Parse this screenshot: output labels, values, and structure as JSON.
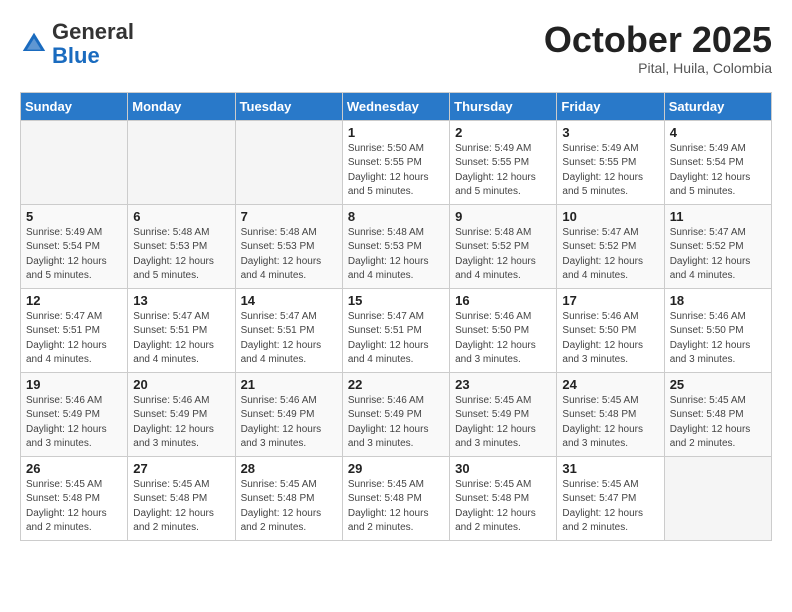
{
  "header": {
    "logo_general": "General",
    "logo_blue": "Blue",
    "month": "October 2025",
    "location": "Pital, Huila, Colombia"
  },
  "weekdays": [
    "Sunday",
    "Monday",
    "Tuesday",
    "Wednesday",
    "Thursday",
    "Friday",
    "Saturday"
  ],
  "weeks": [
    [
      {
        "day": "",
        "info": ""
      },
      {
        "day": "",
        "info": ""
      },
      {
        "day": "",
        "info": ""
      },
      {
        "day": "1",
        "info": "Sunrise: 5:50 AM\nSunset: 5:55 PM\nDaylight: 12 hours\nand 5 minutes."
      },
      {
        "day": "2",
        "info": "Sunrise: 5:49 AM\nSunset: 5:55 PM\nDaylight: 12 hours\nand 5 minutes."
      },
      {
        "day": "3",
        "info": "Sunrise: 5:49 AM\nSunset: 5:55 PM\nDaylight: 12 hours\nand 5 minutes."
      },
      {
        "day": "4",
        "info": "Sunrise: 5:49 AM\nSunset: 5:54 PM\nDaylight: 12 hours\nand 5 minutes."
      }
    ],
    [
      {
        "day": "5",
        "info": "Sunrise: 5:49 AM\nSunset: 5:54 PM\nDaylight: 12 hours\nand 5 minutes."
      },
      {
        "day": "6",
        "info": "Sunrise: 5:48 AM\nSunset: 5:53 PM\nDaylight: 12 hours\nand 5 minutes."
      },
      {
        "day": "7",
        "info": "Sunrise: 5:48 AM\nSunset: 5:53 PM\nDaylight: 12 hours\nand 4 minutes."
      },
      {
        "day": "8",
        "info": "Sunrise: 5:48 AM\nSunset: 5:53 PM\nDaylight: 12 hours\nand 4 minutes."
      },
      {
        "day": "9",
        "info": "Sunrise: 5:48 AM\nSunset: 5:52 PM\nDaylight: 12 hours\nand 4 minutes."
      },
      {
        "day": "10",
        "info": "Sunrise: 5:47 AM\nSunset: 5:52 PM\nDaylight: 12 hours\nand 4 minutes."
      },
      {
        "day": "11",
        "info": "Sunrise: 5:47 AM\nSunset: 5:52 PM\nDaylight: 12 hours\nand 4 minutes."
      }
    ],
    [
      {
        "day": "12",
        "info": "Sunrise: 5:47 AM\nSunset: 5:51 PM\nDaylight: 12 hours\nand 4 minutes."
      },
      {
        "day": "13",
        "info": "Sunrise: 5:47 AM\nSunset: 5:51 PM\nDaylight: 12 hours\nand 4 minutes."
      },
      {
        "day": "14",
        "info": "Sunrise: 5:47 AM\nSunset: 5:51 PM\nDaylight: 12 hours\nand 4 minutes."
      },
      {
        "day": "15",
        "info": "Sunrise: 5:47 AM\nSunset: 5:51 PM\nDaylight: 12 hours\nand 4 minutes."
      },
      {
        "day": "16",
        "info": "Sunrise: 5:46 AM\nSunset: 5:50 PM\nDaylight: 12 hours\nand 3 minutes."
      },
      {
        "day": "17",
        "info": "Sunrise: 5:46 AM\nSunset: 5:50 PM\nDaylight: 12 hours\nand 3 minutes."
      },
      {
        "day": "18",
        "info": "Sunrise: 5:46 AM\nSunset: 5:50 PM\nDaylight: 12 hours\nand 3 minutes."
      }
    ],
    [
      {
        "day": "19",
        "info": "Sunrise: 5:46 AM\nSunset: 5:49 PM\nDaylight: 12 hours\nand 3 minutes."
      },
      {
        "day": "20",
        "info": "Sunrise: 5:46 AM\nSunset: 5:49 PM\nDaylight: 12 hours\nand 3 minutes."
      },
      {
        "day": "21",
        "info": "Sunrise: 5:46 AM\nSunset: 5:49 PM\nDaylight: 12 hours\nand 3 minutes."
      },
      {
        "day": "22",
        "info": "Sunrise: 5:46 AM\nSunset: 5:49 PM\nDaylight: 12 hours\nand 3 minutes."
      },
      {
        "day": "23",
        "info": "Sunrise: 5:45 AM\nSunset: 5:49 PM\nDaylight: 12 hours\nand 3 minutes."
      },
      {
        "day": "24",
        "info": "Sunrise: 5:45 AM\nSunset: 5:48 PM\nDaylight: 12 hours\nand 3 minutes."
      },
      {
        "day": "25",
        "info": "Sunrise: 5:45 AM\nSunset: 5:48 PM\nDaylight: 12 hours\nand 2 minutes."
      }
    ],
    [
      {
        "day": "26",
        "info": "Sunrise: 5:45 AM\nSunset: 5:48 PM\nDaylight: 12 hours\nand 2 minutes."
      },
      {
        "day": "27",
        "info": "Sunrise: 5:45 AM\nSunset: 5:48 PM\nDaylight: 12 hours\nand 2 minutes."
      },
      {
        "day": "28",
        "info": "Sunrise: 5:45 AM\nSunset: 5:48 PM\nDaylight: 12 hours\nand 2 minutes."
      },
      {
        "day": "29",
        "info": "Sunrise: 5:45 AM\nSunset: 5:48 PM\nDaylight: 12 hours\nand 2 minutes."
      },
      {
        "day": "30",
        "info": "Sunrise: 5:45 AM\nSunset: 5:48 PM\nDaylight: 12 hours\nand 2 minutes."
      },
      {
        "day": "31",
        "info": "Sunrise: 5:45 AM\nSunset: 5:47 PM\nDaylight: 12 hours\nand 2 minutes."
      },
      {
        "day": "",
        "info": ""
      }
    ]
  ]
}
